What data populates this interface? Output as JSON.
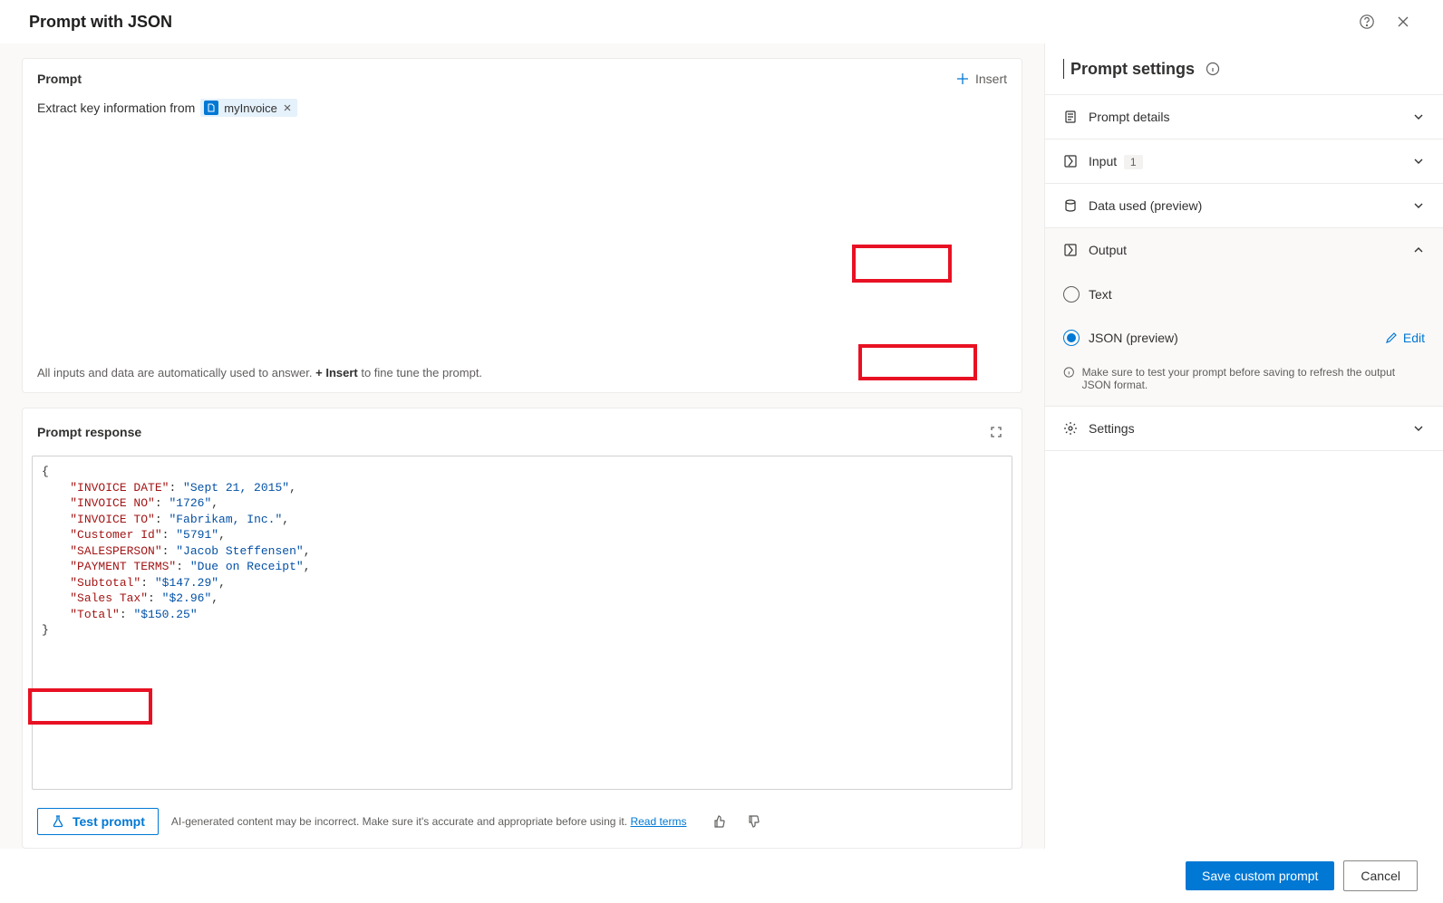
{
  "header": {
    "title": "Prompt with JSON"
  },
  "prompt": {
    "card_title": "Prompt",
    "insert_label": "Insert",
    "text_prefix": "Extract key information from",
    "chip_label": "myInvoice",
    "footer_pre": "All inputs and data are automatically used to answer. ",
    "footer_bold": "+ Insert",
    "footer_post": " to fine tune the prompt."
  },
  "response": {
    "card_title": "Prompt response",
    "test_label": "Test prompt",
    "disclaimer": "AI-generated content may be incorrect. Make sure it's accurate and appropriate before using it. ",
    "read_terms": "Read terms",
    "json": {
      "INVOICE DATE": "Sept 21, 2015",
      "INVOICE NO": "1726",
      "INVOICE TO": "Fabrikam, Inc.",
      "Customer Id": "5791",
      "SALESPERSON": "Jacob Steffensen",
      "PAYMENT TERMS": "Due on Receipt",
      "Subtotal": "$147.29",
      "Sales Tax": "$2.96",
      "Total": "$150.25"
    }
  },
  "settings": {
    "title": "Prompt settings",
    "items": {
      "details_label": "Prompt details",
      "input_label": "Input",
      "input_count": "1",
      "data_label": "Data used (preview)",
      "output_label": "Output",
      "settings_label": "Settings"
    },
    "output": {
      "text_label": "Text",
      "json_label": "JSON (preview)",
      "edit_label": "Edit",
      "info": "Make sure to test your prompt before saving to refresh the output JSON format."
    }
  },
  "footer": {
    "save": "Save custom prompt",
    "cancel": "Cancel"
  }
}
